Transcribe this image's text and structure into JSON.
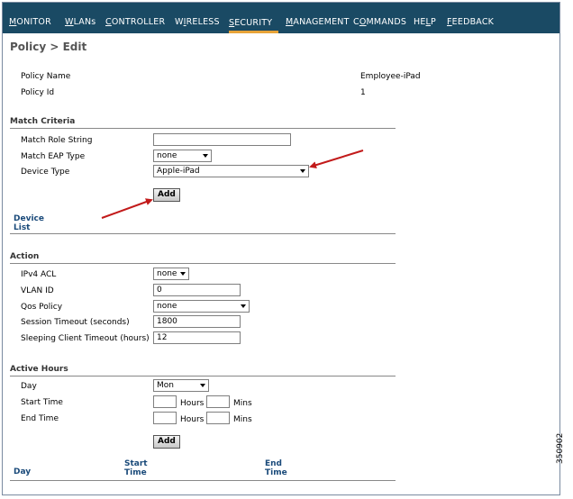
{
  "nav": {
    "items": [
      {
        "key": "M",
        "rest": "ONITOR"
      },
      {
        "key": "W",
        "rest": "LANs"
      },
      {
        "key": "C",
        "rest": "ONTROLLER"
      },
      {
        "pre": "W",
        "key": "I",
        "rest": "RELESS"
      },
      {
        "key": "S",
        "rest": "ECURITY"
      },
      {
        "key": "M",
        "rest": "ANAGEMENT"
      },
      {
        "pre": "C",
        "key": "O",
        "rest": "MMANDS"
      },
      {
        "pre": "HE",
        "key": "L",
        "rest": "P"
      },
      {
        "key": "F",
        "rest": "EEDBACK"
      }
    ],
    "active_index": 4,
    "colors": {
      "bar": "#1a4a64",
      "active_underline": "#e7a339"
    }
  },
  "page_title": "Policy > Edit",
  "policy": {
    "name_label": "Policy Name",
    "name_value": "Employee-iPad",
    "id_label": "Policy Id",
    "id_value": "1"
  },
  "match": {
    "section": "Match Criteria",
    "role_label": "Match Role String",
    "role_value": "",
    "eap_label": "Match EAP Type",
    "eap_value": "none",
    "device_label": "Device Type",
    "device_value": "Apple-iPad",
    "add_label": "Add",
    "device_list_line1": "Device",
    "device_list_line2": "List"
  },
  "action": {
    "section": "Action",
    "acl_label": "IPv4 ACL",
    "acl_value": "none",
    "vlan_label": "VLAN ID",
    "vlan_value": "0",
    "qos_label": "Qos Policy",
    "qos_value": "none",
    "session_label": "Session Timeout (seconds)",
    "session_value": "1800",
    "sleep_label": "Sleeping Client Timeout (hours)",
    "sleep_value": "12"
  },
  "hours": {
    "section": "Active Hours",
    "day_label": "Day",
    "day_value": "Mon",
    "start_label": "Start Time",
    "end_label": "End Time",
    "hours_unit": "Hours",
    "mins_unit": "Mins",
    "add_label": "Add",
    "col_day": "Day",
    "col_start_1": "Start",
    "col_start_2": "Time",
    "col_end_1": "End",
    "col_end_2": "Time"
  },
  "figure_number": "350902"
}
